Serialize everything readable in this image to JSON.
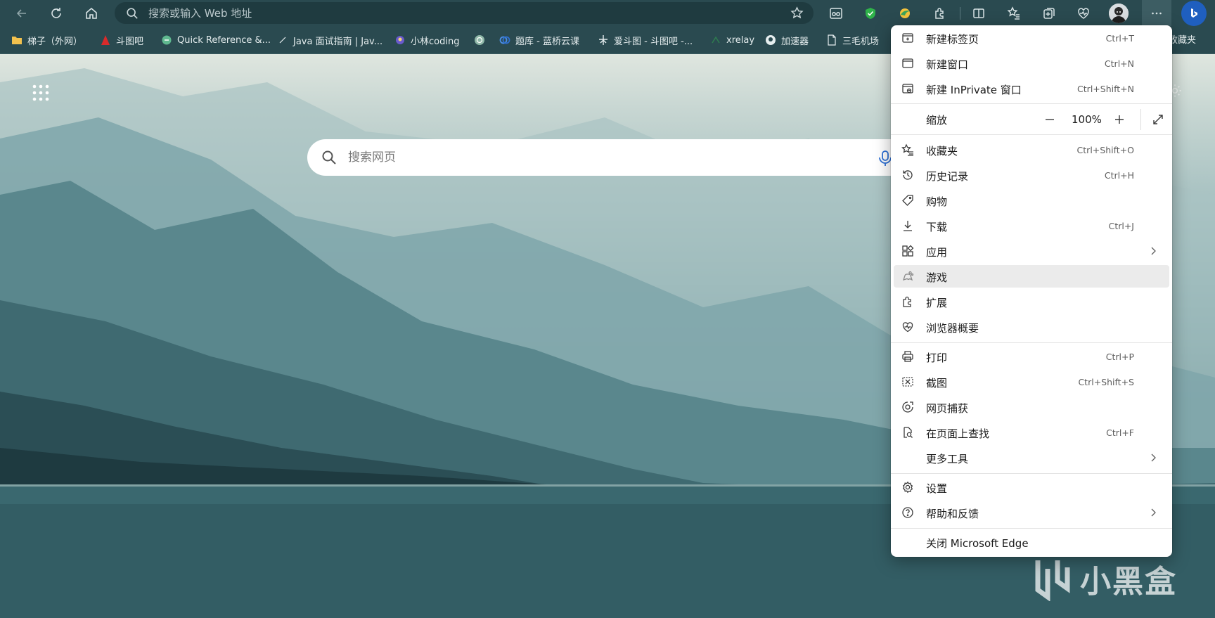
{
  "toolbar": {
    "address_placeholder": "搜索或输入 Web 地址"
  },
  "bookmarks": [
    {
      "label": "梯子（外网）",
      "icon": "folder-icon"
    },
    {
      "label": "斗图吧",
      "icon": "site-icon"
    },
    {
      "label": "Quick Reference &...",
      "icon": "site-icon"
    },
    {
      "label": "Java 面试指南 | Jav...",
      "icon": "site-icon"
    },
    {
      "label": "小林coding",
      "icon": "site-icon"
    },
    {
      "label": "",
      "icon": "openai-icon"
    },
    {
      "label": "题库 - 蓝桥云课",
      "icon": "site-icon"
    },
    {
      "label": "爱斗图 - 斗图吧 -...",
      "icon": "site-icon"
    },
    {
      "label": "xrelay",
      "icon": "site-icon"
    },
    {
      "label": "加速器",
      "icon": "github-icon"
    },
    {
      "label": "三毛机场",
      "icon": "page-icon"
    }
  ],
  "bookmarks_right_label": "收藏夹",
  "newtab": {
    "search_placeholder": "搜索网页"
  },
  "watermark": {
    "text": "小黑盒"
  },
  "menu": {
    "items": [
      {
        "label": "新建标签页",
        "shortcut": "Ctrl+T",
        "icon": "new-tab-icon"
      },
      {
        "label": "新建窗口",
        "shortcut": "Ctrl+N",
        "icon": "new-window-icon"
      },
      {
        "label": "新建 InPrivate 窗口",
        "shortcut": "Ctrl+Shift+N",
        "icon": "inprivate-icon"
      },
      {
        "label": "收藏夹",
        "shortcut": "Ctrl+Shift+O",
        "icon": "favorites-icon"
      },
      {
        "label": "历史记录",
        "shortcut": "Ctrl+H",
        "icon": "history-icon"
      },
      {
        "label": "购物",
        "shortcut": "",
        "icon": "shopping-tag-icon"
      },
      {
        "label": "下载",
        "shortcut": "Ctrl+J",
        "icon": "download-icon"
      },
      {
        "label": "应用",
        "shortcut": "",
        "icon": "apps-icon"
      },
      {
        "label": "游戏",
        "shortcut": "",
        "icon": "games-icon"
      },
      {
        "label": "扩展",
        "shortcut": "",
        "icon": "extensions-icon"
      },
      {
        "label": "浏览器概要",
        "shortcut": "",
        "icon": "browser-essentials-icon"
      },
      {
        "label": "打印",
        "shortcut": "Ctrl+P",
        "icon": "print-icon"
      },
      {
        "label": "截图",
        "shortcut": "Ctrl+Shift+S",
        "icon": "screenshot-icon"
      },
      {
        "label": "网页捕获",
        "shortcut": "",
        "icon": "web-capture-icon"
      },
      {
        "label": "在页面上查找",
        "shortcut": "Ctrl+F",
        "icon": "find-icon"
      },
      {
        "label": "更多工具",
        "shortcut": "",
        "icon": ""
      },
      {
        "label": "设置",
        "shortcut": "",
        "icon": "settings-icon"
      },
      {
        "label": "帮助和反馈",
        "shortcut": "",
        "icon": "help-icon"
      },
      {
        "label": "关闭 Microsoft Edge",
        "shortcut": "",
        "icon": ""
      }
    ],
    "zoom": {
      "label": "缩放",
      "value": "100%"
    },
    "hover_item": "游戏"
  },
  "colors": {
    "toolbar_bg": "#2a4a50",
    "menu_bg": "#ffffff",
    "menu_hover": "#ebebeb"
  }
}
